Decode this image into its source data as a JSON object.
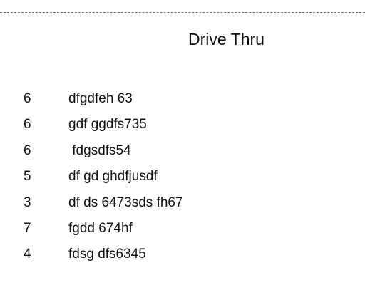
{
  "order": {
    "title": "Drive Thru",
    "items": [
      {
        "qty": "6",
        "name": "dfgdfeh 63"
      },
      {
        "qty": "6",
        "name": "gdf ggdfs735"
      },
      {
        "qty": "6",
        "name": " fdgsdfs54"
      },
      {
        "qty": "5",
        "name": "df gd ghdfjusdf"
      },
      {
        "qty": "3",
        "name": "df ds 6473sds fh67"
      },
      {
        "qty": "7",
        "name": "fgdd 674hf"
      },
      {
        "qty": "4",
        "name": "fdsg dfs6345"
      }
    ]
  }
}
